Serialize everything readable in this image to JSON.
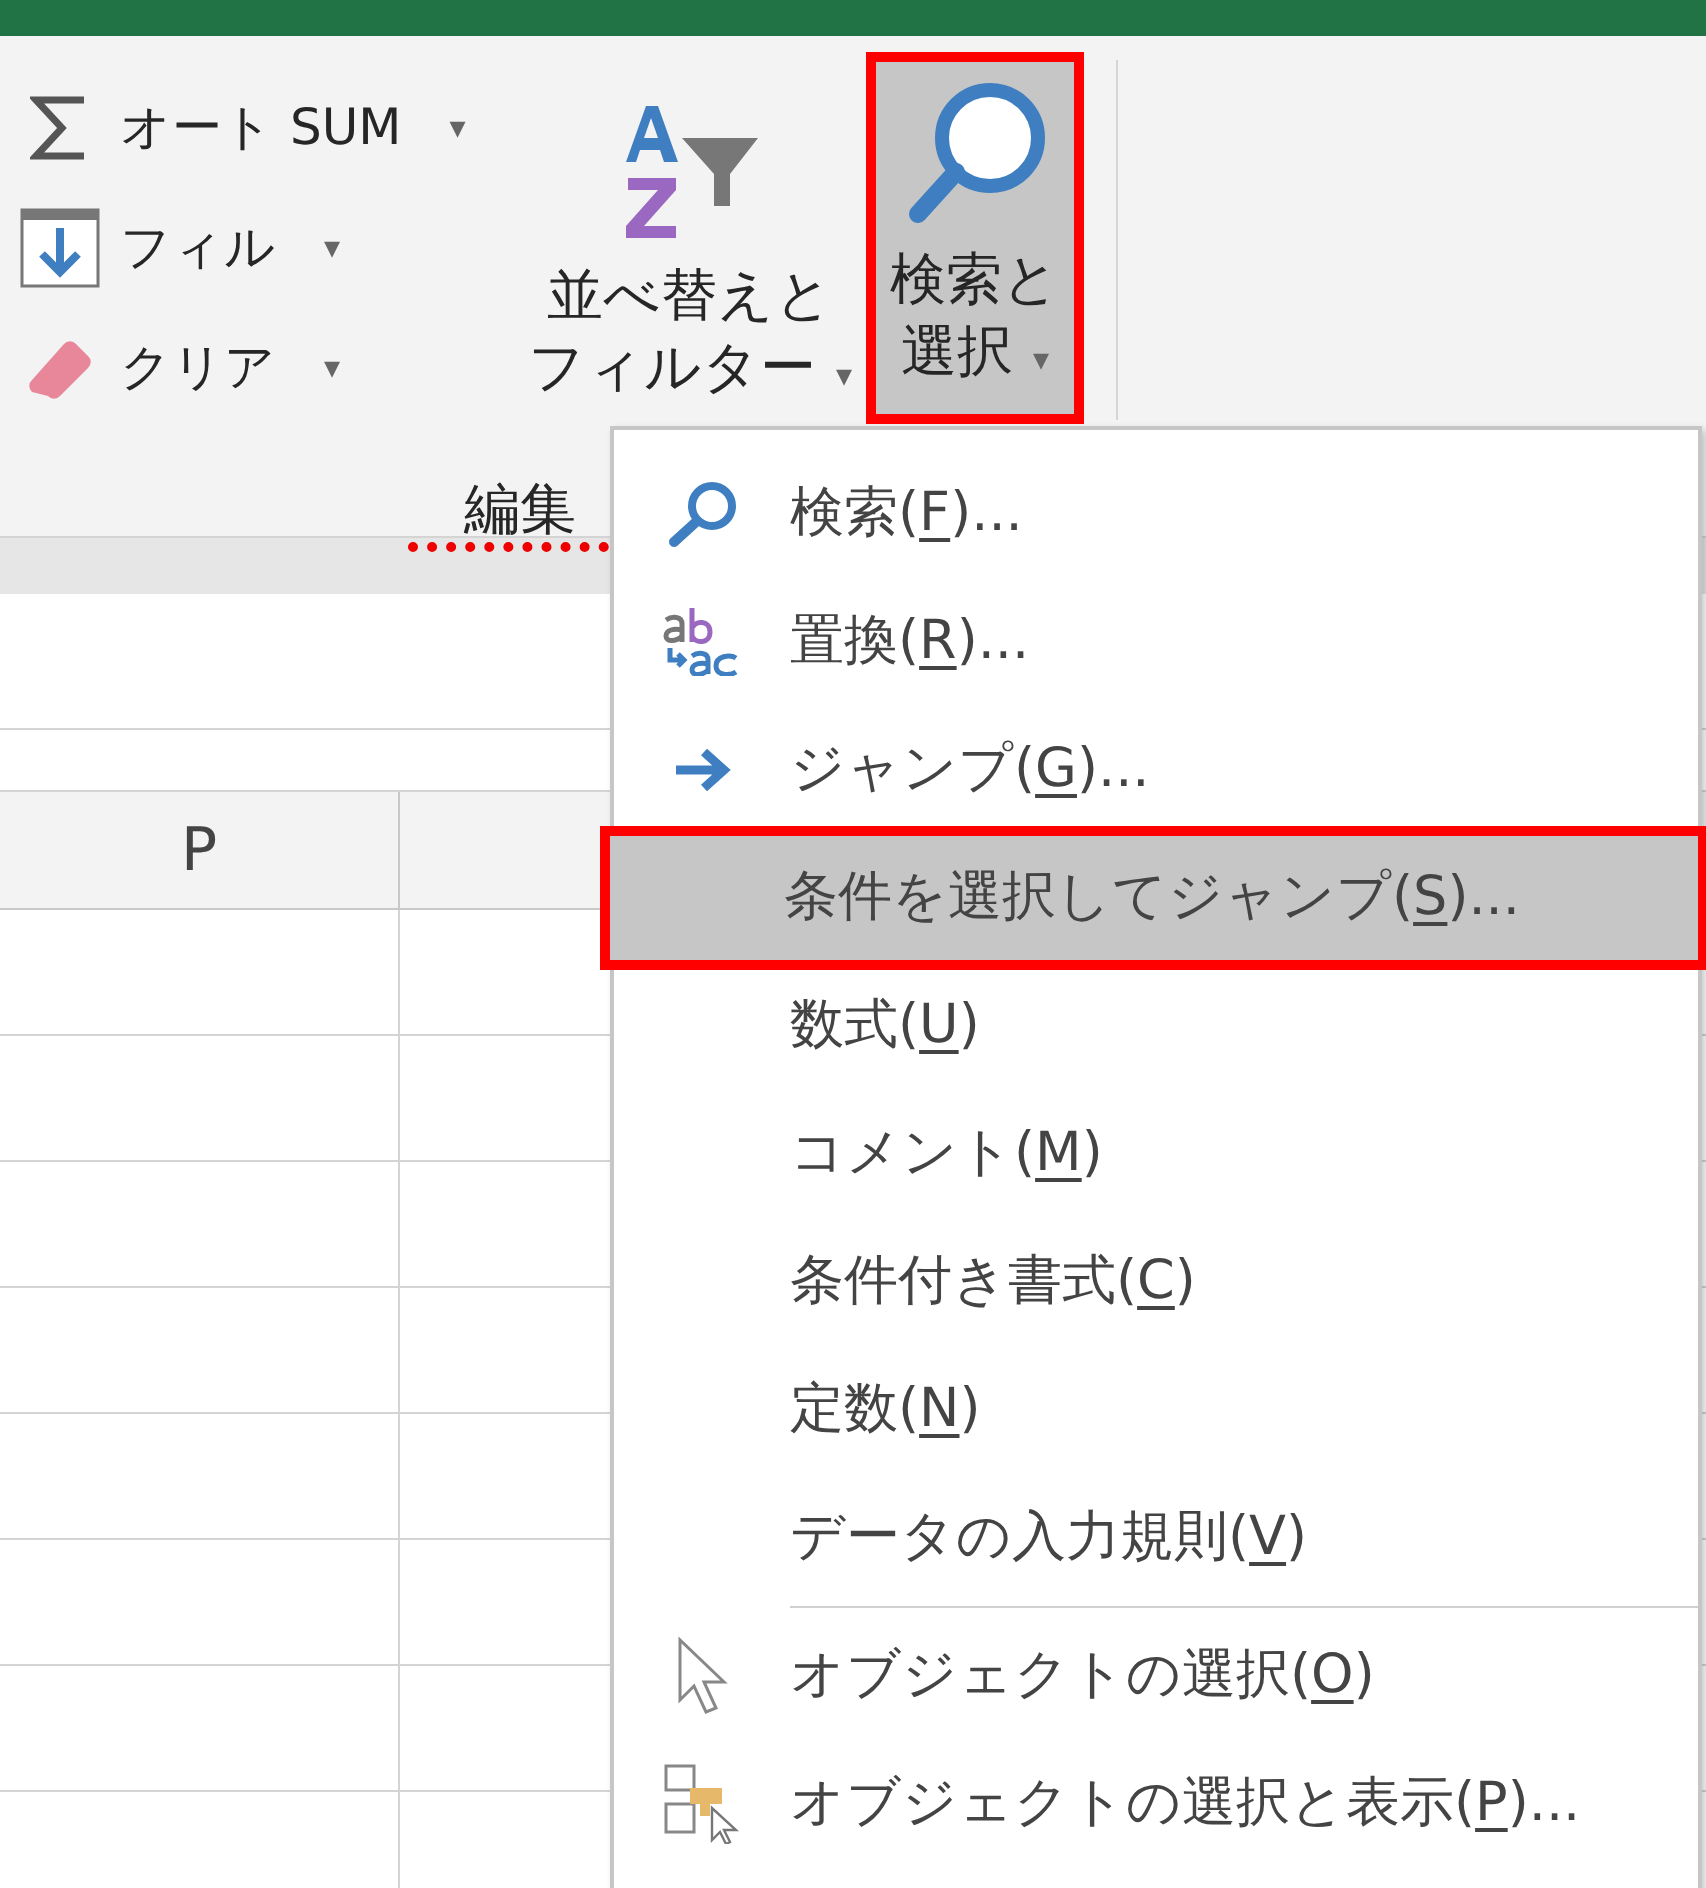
{
  "ribbon": {
    "small_buttons": [
      {
        "kind": "sum",
        "label": "オート SUM",
        "caret": "▾"
      },
      {
        "kind": "fill",
        "label": "フィル",
        "caret": "▾"
      },
      {
        "kind": "eraser",
        "label": "クリア",
        "caret": "▾"
      }
    ],
    "large_buttons": [
      {
        "kind": "sort-filter",
        "lines": [
          "並べ替えと",
          "フィルター"
        ],
        "caret": "▾",
        "pressed": false,
        "highlighted": false
      },
      {
        "kind": "search",
        "lines": [
          "検索と",
          "選択"
        ],
        "caret": "▾",
        "pressed": true,
        "highlighted": true
      }
    ],
    "group_label": {
      "text": "編集",
      "marked": true
    }
  },
  "sheet": {
    "columns": [
      "P"
    ]
  },
  "menu": {
    "items": [
      {
        "kind": "search",
        "before": "検索(",
        "key": "F",
        "after": ")...",
        "highlighted": false
      },
      {
        "kind": "replace",
        "before": "置換(",
        "key": "R",
        "after": ")...",
        "highlighted": false
      },
      {
        "kind": "arrow",
        "before": "ジャンプ(",
        "key": "G",
        "after": ")...",
        "highlighted": false
      },
      {
        "kind": "plain",
        "before": "条件を選択してジャンプ(",
        "key": "S",
        "after": ")...",
        "highlighted": true
      },
      {
        "kind": "plain",
        "before": "数式(",
        "key": "U",
        "after": ")",
        "highlighted": false
      },
      {
        "kind": "plain",
        "before": "コメント(",
        "key": "M",
        "after": ")",
        "highlighted": false
      },
      {
        "kind": "plain",
        "before": "条件付き書式(",
        "key": "C",
        "after": ")",
        "highlighted": false
      },
      {
        "kind": "plain",
        "before": "定数(",
        "key": "N",
        "after": ")",
        "highlighted": false
      },
      {
        "kind": "plain",
        "before": "データの入力規則(",
        "key": "V",
        "after": ")",
        "highlighted": false,
        "separator_after": true
      },
      {
        "kind": "pointer",
        "before": "オブジェクトの選択(",
        "key": "O",
        "after": ")",
        "highlighted": false
      },
      {
        "kind": "selection-pane",
        "before": "オブジェクトの選択と表示(",
        "key": "P",
        "after": ")...",
        "highlighted": false
      }
    ]
  }
}
